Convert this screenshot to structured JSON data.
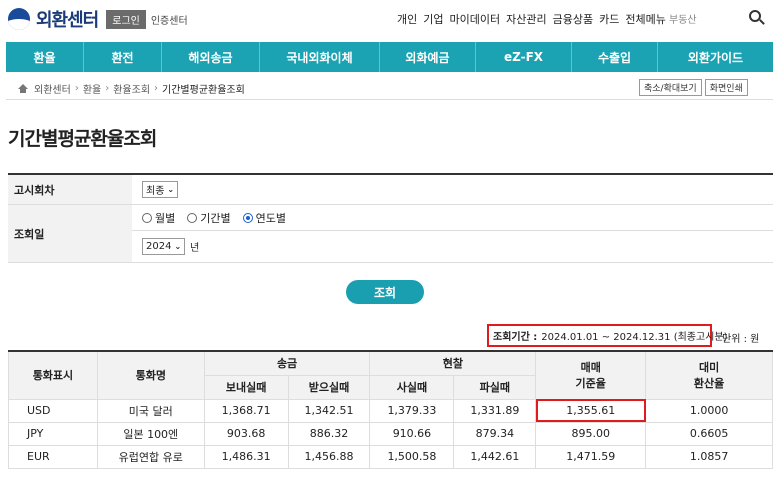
{
  "header": {
    "logo_text": "외환센터",
    "login_label": "로그인",
    "cert_label": "인증센터",
    "top_links": [
      "개인",
      "기업",
      "마이데이터",
      "자산관리",
      "금융상품",
      "카드",
      "전체메뉴"
    ],
    "search_value": "부동산",
    "colors": {
      "brand": "#1a3a7a",
      "accent": "#1ba3b3"
    }
  },
  "main_nav": [
    "환율",
    "환전",
    "해외송금",
    "국내외화이체",
    "외화예금",
    "eZ-FX",
    "수출입",
    "외환가이드"
  ],
  "breadcrumb": [
    "외환센터",
    "환율",
    "환율조회",
    "기간별평균환율조회"
  ],
  "utility_buttons": [
    "축소/확대보기",
    "화면인쇄"
  ],
  "page_title": "기간별평균환율조회",
  "form": {
    "notice_label": "고시회차",
    "notice_value": "최종",
    "date_label": "조회일",
    "radio_options": [
      {
        "label": "월별",
        "checked": false
      },
      {
        "label": "기간별",
        "checked": false
      },
      {
        "label": "연도별",
        "checked": true
      }
    ],
    "year_value": "2024",
    "year_suffix": "년",
    "submit_label": "조회"
  },
  "result": {
    "period_label": "조회기간 :",
    "period_value": "2024.01.01 ~ 2024.12.31 (최종고시분)",
    "unit_label": "단위 : 원",
    "headers": {
      "code": "통화표시",
      "name": "통화명",
      "transfer": "송금",
      "send": "보내실때",
      "receive": "받으실때",
      "cash": "현찰",
      "buy": "사실때",
      "sell": "파실때",
      "base": "매매\n기준율",
      "usd_conv": "대미\n환산율"
    },
    "rows": [
      {
        "code": "USD",
        "name": "미국 달러",
        "send": "1,368.71",
        "receive": "1,342.51",
        "buy": "1,379.33",
        "sell": "1,331.89",
        "base": "1,355.61",
        "usd": "1.0000"
      },
      {
        "code": "JPY",
        "name": "일본 100엔",
        "send": "903.68",
        "receive": "886.32",
        "buy": "910.66",
        "sell": "879.34",
        "base": "895.00",
        "usd": "0.6605"
      },
      {
        "code": "EUR",
        "name": "유럽연합 유로",
        "send": "1,486.31",
        "receive": "1,456.88",
        "buy": "1,500.58",
        "sell": "1,442.61",
        "base": "1,471.59",
        "usd": "1.0857"
      }
    ]
  }
}
